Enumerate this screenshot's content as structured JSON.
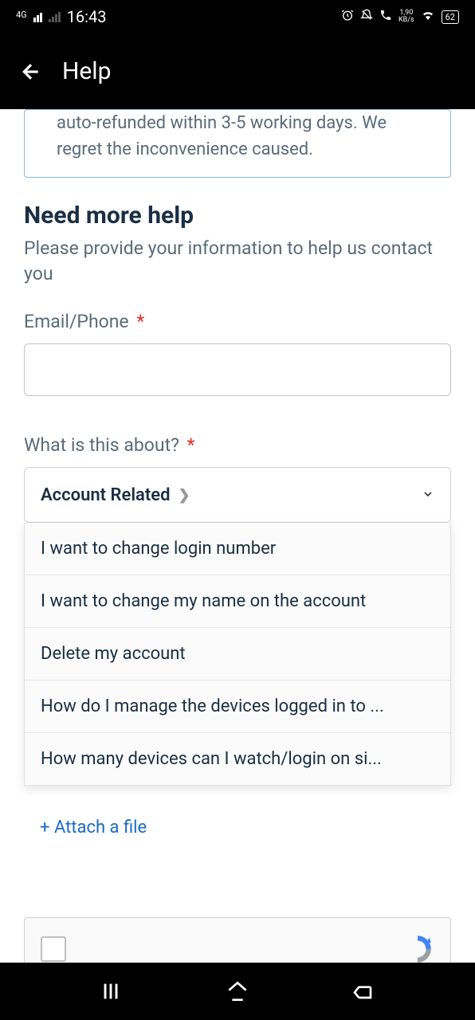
{
  "status_bar": {
    "network": "4G",
    "time": "16:43",
    "data_rate": "1,90",
    "data_unit": "KB/s",
    "battery": "62"
  },
  "header": {
    "title": "Help"
  },
  "info_box": {
    "text": "auto-refunded within 3-5 working days. We regret the inconvenience caused."
  },
  "form": {
    "section_title": "Need more help",
    "section_subtitle": "Please provide your information to help us contact you",
    "email_phone_label": "Email/Phone",
    "about_label": "What is this about?",
    "selected_category": "Account Related",
    "options": [
      "I want to change login number",
      "I want to change my name on the account",
      "Delete my account",
      "How do I manage the devices logged in to ...",
      "How many devices can I watch/login on si..."
    ],
    "attach_file": "+ Attach a file"
  }
}
